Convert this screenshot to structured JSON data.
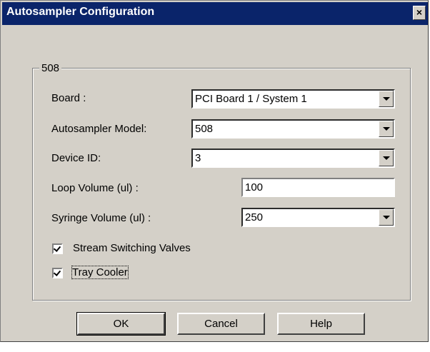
{
  "window": {
    "title": "Autosampler Configuration",
    "close_glyph": "×"
  },
  "group": {
    "label": "508"
  },
  "fields": {
    "board": {
      "label": "Board :",
      "value": "PCI Board 1 / System 1"
    },
    "model": {
      "label": "Autosampler Model:",
      "value": "508"
    },
    "device_id": {
      "label": "Device ID:",
      "value": "3"
    },
    "loop_volume": {
      "label": "Loop Volume (ul) :",
      "value": "100"
    },
    "syringe_volume": {
      "label": "Syringe Volume (ul) :",
      "value": "250"
    }
  },
  "checkboxes": {
    "stream_switching": {
      "label": "Stream Switching Valves",
      "checked": true
    },
    "tray_cooler": {
      "label": "Tray Cooler",
      "checked": true
    }
  },
  "buttons": {
    "ok": "OK",
    "cancel": "Cancel",
    "help": "Help"
  },
  "colors": {
    "title_bar": "#0a246a",
    "face": "#d4d0c8"
  }
}
